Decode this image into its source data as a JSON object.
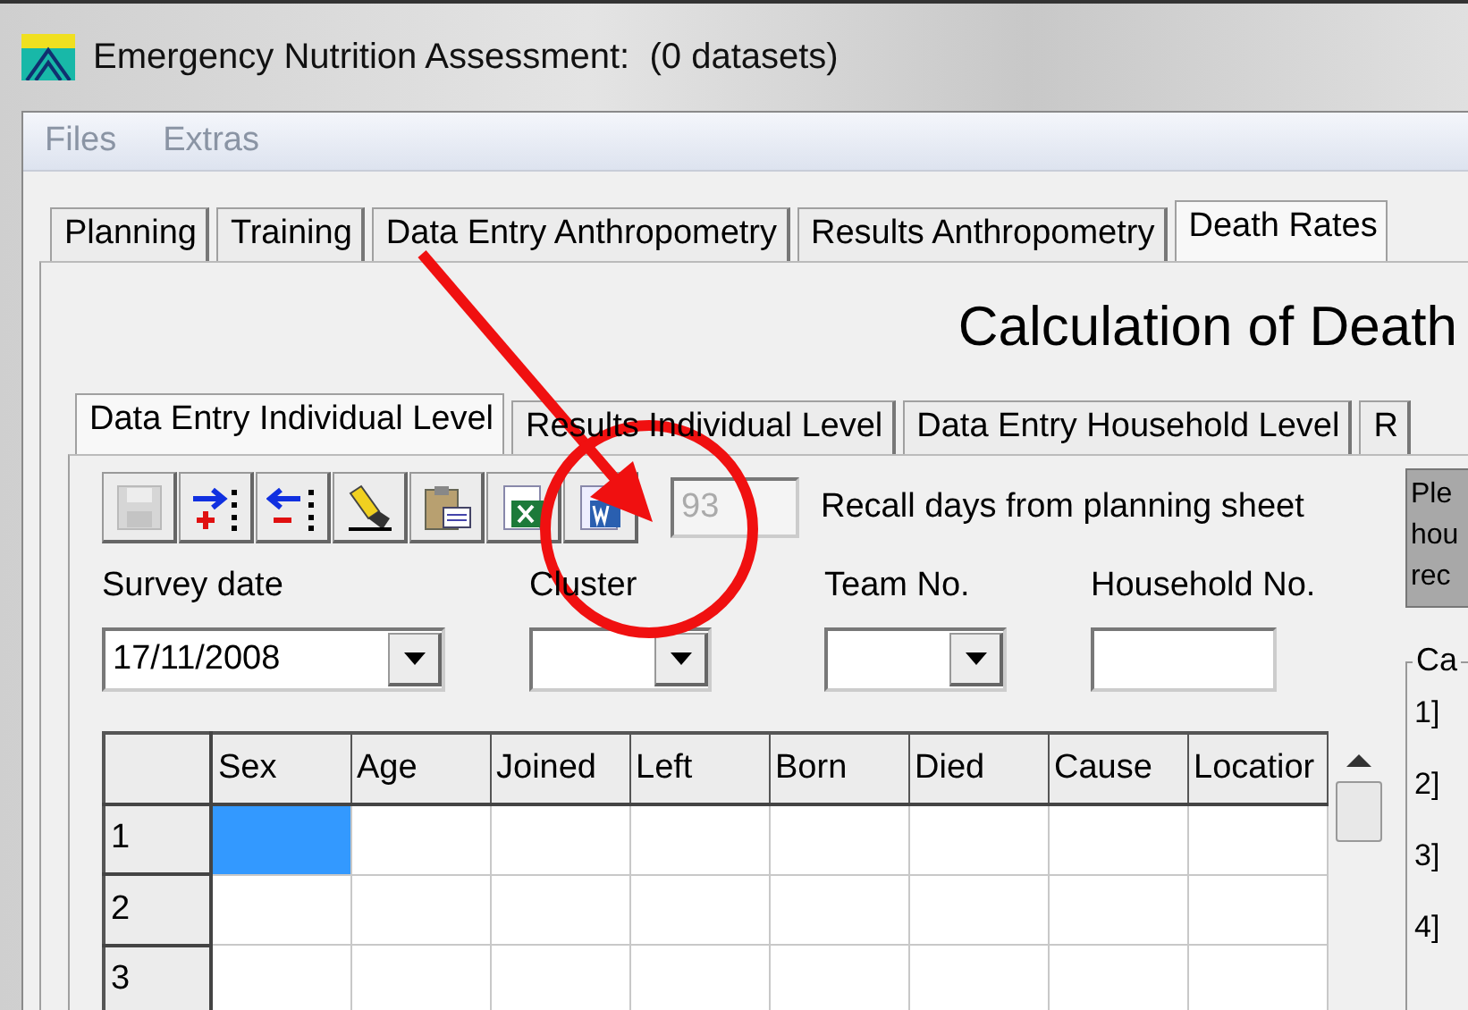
{
  "window": {
    "title": "Emergency Nutrition Assessment:  (0 datasets)"
  },
  "menu": [
    {
      "label": "Files"
    },
    {
      "label": "Extras"
    }
  ],
  "tabs": [
    {
      "label": "Planning",
      "selected": false
    },
    {
      "label": "Training",
      "selected": false
    },
    {
      "label": "Data Entry Anthropometry",
      "selected": false
    },
    {
      "label": "Results Anthropometry",
      "selected": false
    },
    {
      "label": "Death Rates",
      "selected": true
    }
  ],
  "page_title": "Calculation of Death",
  "subtabs": [
    {
      "label": "Data Entry Individual Level",
      "selected": true
    },
    {
      "label": "Results Individual Level",
      "selected": false
    },
    {
      "label": "Data Entry Household Level",
      "selected": false
    },
    {
      "label": "R",
      "selected": false
    }
  ],
  "toolbar": [
    {
      "kind": "save",
      "disabled": true
    },
    {
      "kind": "add",
      "disabled": false
    },
    {
      "kind": "remove",
      "disabled": false
    },
    {
      "kind": "pen",
      "disabled": false
    },
    {
      "kind": "clipboard",
      "disabled": false
    },
    {
      "kind": "excel",
      "disabled": false
    },
    {
      "kind": "word",
      "disabled": false
    }
  ],
  "recall": {
    "value": "93",
    "disabled": true,
    "label": "Recall days from planning sheet"
  },
  "fields": [
    {
      "label": "Survey date",
      "kind": "dropdown",
      "value": "17/11/2008"
    },
    {
      "label": "Cluster",
      "kind": "dropdown"
    },
    {
      "label": "Team No.",
      "kind": "dropdown"
    },
    {
      "label": "Household No.",
      "kind": "text"
    }
  ],
  "info_box": {
    "lines": [
      "Ple",
      "hou",
      "rec"
    ]
  },
  "group": {
    "title": "Ca",
    "items": [
      "1]",
      "2]",
      "3]",
      "4]"
    ]
  },
  "grid": {
    "columns": [
      "Sex",
      "Age",
      "Joined",
      "Left",
      "Born",
      "Died",
      "Cause",
      "Locatior"
    ],
    "rows": [
      {
        "header": "1",
        "cells": [
          {
            "selected": true
          },
          {
            "selected": false
          },
          {
            "selected": false
          },
          {
            "selected": false
          },
          {
            "selected": false
          },
          {
            "selected": false
          },
          {
            "selected": false
          },
          {
            "selected": false
          }
        ]
      },
      {
        "header": "2",
        "cells": [
          {
            "selected": false
          },
          {
            "selected": false
          },
          {
            "selected": false
          },
          {
            "selected": false
          },
          {
            "selected": false
          },
          {
            "selected": false
          },
          {
            "selected": false
          },
          {
            "selected": false
          }
        ]
      },
      {
        "header": "3",
        "cells": [
          {
            "selected": false
          },
          {
            "selected": false
          },
          {
            "selected": false
          },
          {
            "selected": false
          },
          {
            "selected": false
          },
          {
            "selected": false
          },
          {
            "selected": false
          },
          {
            "selected": false
          }
        ]
      }
    ]
  }
}
